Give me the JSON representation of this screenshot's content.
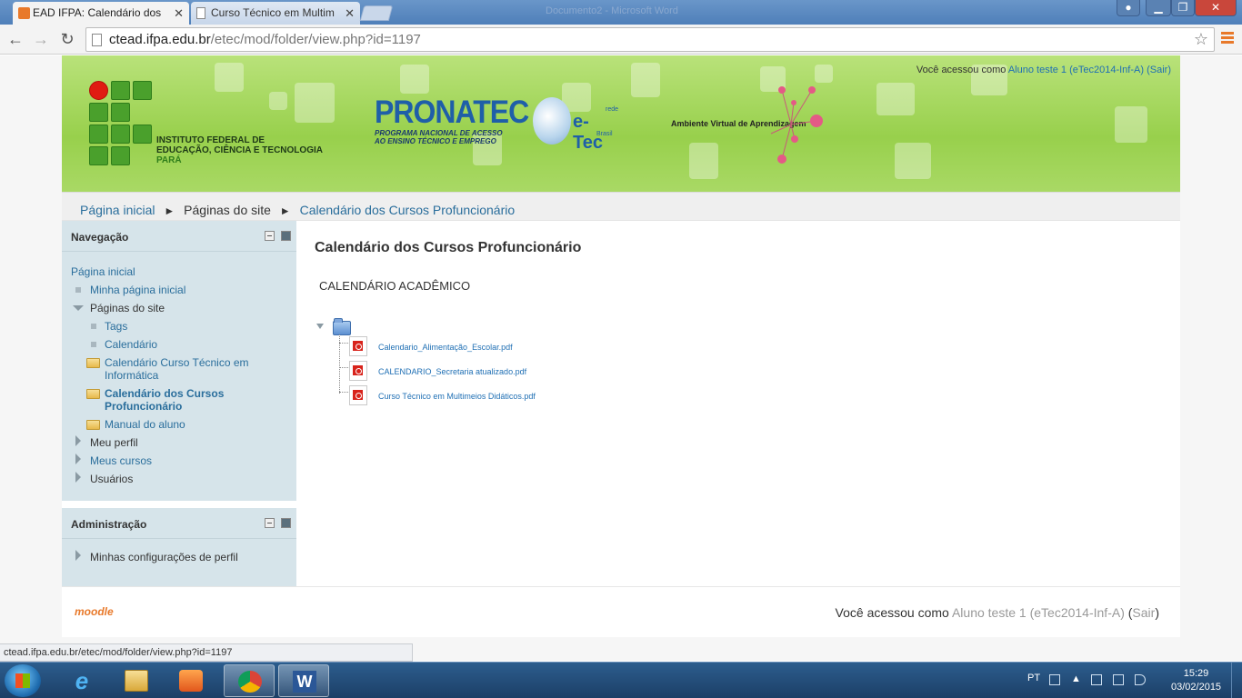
{
  "browser": {
    "tabs": [
      {
        "title": "EAD IFPA: Calendário dos",
        "active": true
      },
      {
        "title": "Curso Técnico em Multim",
        "active": false
      }
    ],
    "window_title": "Documento2 - Microsoft Word",
    "url_host": "ctead.ifpa.edu.br",
    "url_path": "/etec/mod/folder/view.php?id=1197",
    "status_url": "ctead.ifpa.edu.br/etec/mod/folder/view.php?id=1197"
  },
  "header": {
    "login_prefix": "Você acessou como",
    "login_user": "Aluno teste 1 (eTec2014-Inf-A)",
    "login_open": "(",
    "logout": "Sair",
    "login_close": ")",
    "institute_line1": "INSTITUTO FEDERAL DE",
    "institute_line2": "EDUCAÇÃO, CIÊNCIA E TECNOLOGIA",
    "institute_line3": "PARÁ",
    "pronatec_title": "PRONATEC",
    "pronatec_sub1": "PROGRAMA NACIONAL DE ACESSO",
    "pronatec_sub2": "AO ENSINO TÉCNICO E EMPREGO",
    "etec_word": "e-Tec",
    "etec_rede": "rede",
    "etec_brasil": "Brasil",
    "ava_label": "Ambiente Virtual de Aprendizagem",
    "brand_green": "#98d04c"
  },
  "breadcrumb": {
    "items": [
      "Página inicial",
      "Páginas do site",
      "Calendário dos Cursos Profuncionário"
    ],
    "separator": "►"
  },
  "navigation_block": {
    "title": "Navegação",
    "home": "Página inicial",
    "my_home": "Minha página inicial",
    "site_pages": "Páginas do site",
    "tags": "Tags",
    "calendar": "Calendário",
    "folder1_line1": "Calendário Curso Técnico em",
    "folder1_line2": "Informática",
    "folder2_line1": "Calendário dos Cursos",
    "folder2_line2": "Profuncionário",
    "folder3": "Manual do aluno",
    "my_profile": "Meu perfil",
    "my_courses": "Meus cursos",
    "users": "Usuários"
  },
  "admin_block": {
    "title": "Administração",
    "profile_settings": "Minhas configurações de perfil"
  },
  "main": {
    "title": "Calendário dos Cursos Profuncionário",
    "intro": "CALENDÁRIO ACADÊMICO",
    "files": [
      "Calendario_Alimentação_Escolar.pdf",
      "CALENDARIO_Secretaria atualizado.pdf",
      "Curso Técnico em Multimeios Didáticos.pdf"
    ]
  },
  "footer": {
    "moodle_logo": "moodle",
    "login_prefix": "Você acessou como",
    "login_user": "Aluno teste 1 (eTec2014-Inf-A)",
    "login_open": "(",
    "logout": "Sair",
    "login_close": ")"
  },
  "taskbar": {
    "language": "PT",
    "time": "15:29",
    "date": "03/02/2015",
    "apps": [
      "internet-explorer-icon",
      "file-explorer-icon",
      "media-player-icon",
      "chrome-icon",
      "word-icon"
    ]
  }
}
